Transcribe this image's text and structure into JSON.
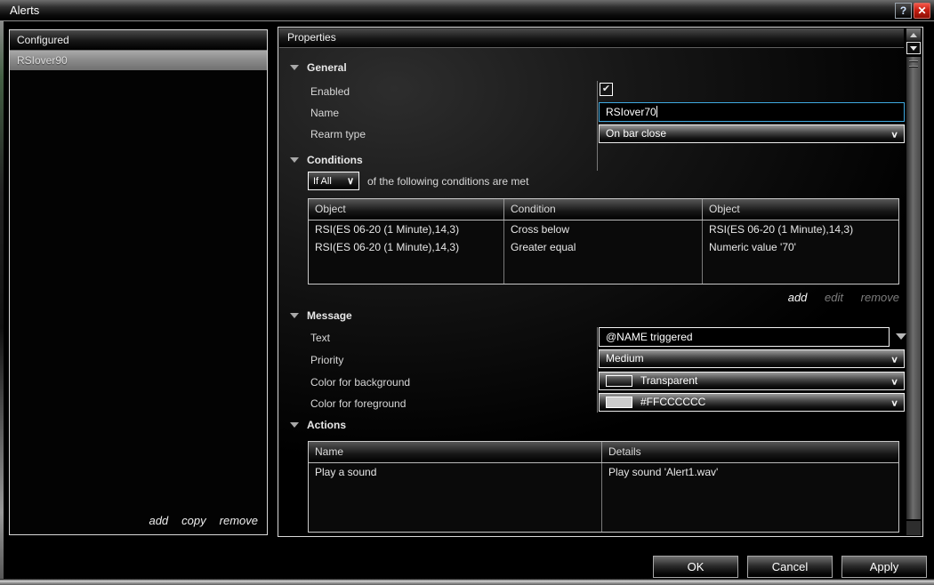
{
  "window": {
    "title": "Alerts",
    "help_label": "?",
    "close_label": "✕"
  },
  "configured_panel": {
    "title": "Configured",
    "items": [
      {
        "name": "RSIover90",
        "selected": true
      }
    ],
    "links": {
      "add": "add",
      "copy": "copy",
      "remove": "remove"
    }
  },
  "properties_panel": {
    "title": "Properties",
    "general": {
      "title": "General",
      "enabled_label": "Enabled",
      "enabled_checked": true,
      "name_label": "Name",
      "name_value": "RSIover70",
      "rearm_label": "Rearm type",
      "rearm_value": "On bar close"
    },
    "conditions": {
      "title": "Conditions",
      "match_value": "If All",
      "match_suffix": "of the following conditions are met",
      "table": {
        "headers": [
          "Object",
          "Condition",
          "Object"
        ],
        "rows": [
          {
            "object1": "RSI(ES 06-20 (1 Minute),14,3)",
            "condition": "Cross below",
            "object2": "RSI(ES 06-20 (1 Minute),14,3)"
          },
          {
            "object1": "RSI(ES 06-20 (1 Minute),14,3)",
            "condition": "Greater equal",
            "object2": "Numeric value '70'"
          }
        ]
      },
      "links": {
        "add": "add",
        "edit": "edit",
        "remove": "remove"
      }
    },
    "message": {
      "title": "Message",
      "text_label": "Text",
      "text_value": "@NAME triggered",
      "priority_label": "Priority",
      "priority_value": "Medium",
      "background_label": "Color for background",
      "background_value": "Transparent",
      "foreground_label": "Color for foreground",
      "foreground_value": "#FFCCCCCC",
      "foreground_swatch": "#CCCCCC"
    },
    "actions": {
      "title": "Actions",
      "table": {
        "headers": [
          "Name",
          "Details"
        ],
        "rows": [
          {
            "name": "Play a sound",
            "details": "Play sound 'Alert1.wav'"
          }
        ]
      }
    }
  },
  "footer": {
    "ok": "OK",
    "cancel": "Cancel",
    "apply": "Apply"
  },
  "colors": {
    "accent_blue": "#3fa9e0",
    "close_red": "#c61f12",
    "selected_item_gray": "#8c8c8c"
  }
}
